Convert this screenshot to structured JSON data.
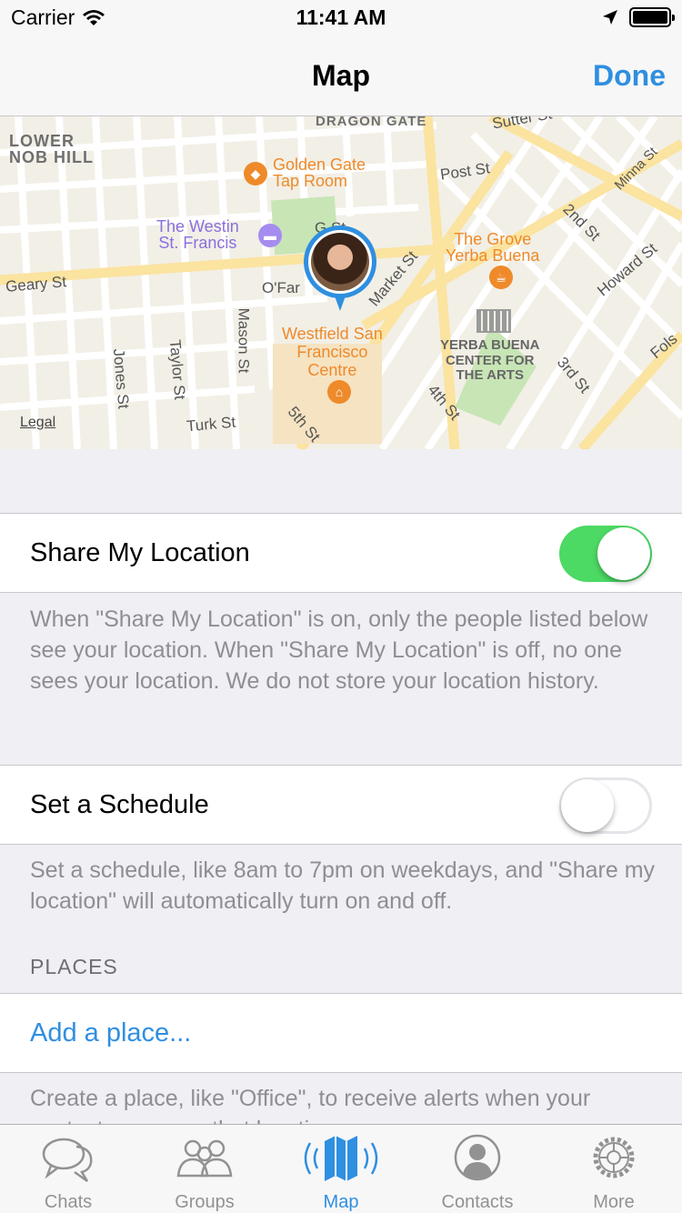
{
  "status_bar": {
    "carrier": "Carrier",
    "time": "11:41 AM"
  },
  "nav": {
    "title": "Map",
    "done": "Done"
  },
  "map": {
    "labels": {
      "lower_nob_hill": "LOWER\nNOB HILL",
      "dragon_gate": "DRAGON GATE",
      "sutter": "Sutter St",
      "golden_gate": "Golden Gate\nTap Room",
      "post": "Post St",
      "minna": "Minna St",
      "second": "2nd St",
      "westin": "The Westin\nSt. Francis",
      "geary": "Geary St",
      "ofarrell": "O'Far",
      "grove": "The Grove\nYerba Buena",
      "howard": "Howard St",
      "market": "Market St",
      "mason": "Mason St",
      "westfield": "Westfield San\nFrancisco\nCentre",
      "yerba": "YERBA BUENA\nCENTER FOR\nTHE ARTS",
      "jones": "Jones St",
      "taylor": "Taylor St",
      "third": "3rd St",
      "fourth": "4th St",
      "fifth": "5th St",
      "turk": "Turk St",
      "folsom": "Fols",
      "geo_st": "G      St"
    },
    "legal": "Legal"
  },
  "share_location": {
    "label": "Share My Location",
    "enabled": true,
    "footer": "When \"Share My Location\" is on, only the people listed below see your location. When \"Share My Location\" is off, no one sees your location. We do not store your location history."
  },
  "schedule": {
    "label": "Set a Schedule",
    "enabled": false,
    "footer": "Set a schedule, like 8am to 7pm on weekdays, and \"Share my location\" will automatically turn on and off."
  },
  "places": {
    "header": "PLACES",
    "add": "Add a place...",
    "footer": "Create a place, like \"Office\", to receive alerts when your contacts are near that location."
  },
  "tabs": [
    {
      "label": "Chats",
      "icon": "chat-bubbles-icon"
    },
    {
      "label": "Groups",
      "icon": "groups-icon"
    },
    {
      "label": "Map",
      "icon": "map-icon"
    },
    {
      "label": "Contacts",
      "icon": "contact-icon"
    },
    {
      "label": "More",
      "icon": "gear-icon"
    }
  ],
  "colors": {
    "accent": "#2f8fe0",
    "toggle_on": "#4cd964",
    "poi_orange": "#ee8a2a",
    "poi_purple": "#8b6fe0"
  }
}
